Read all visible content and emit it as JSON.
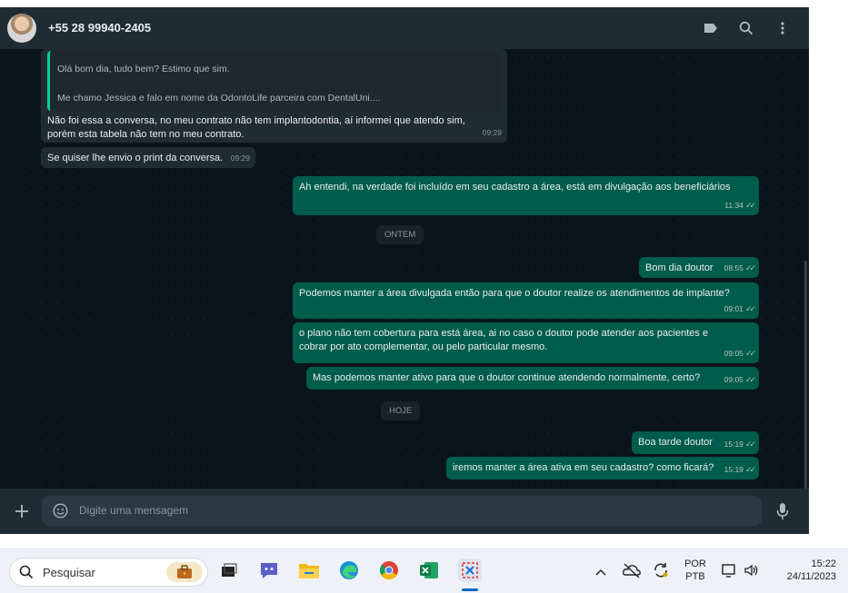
{
  "contact": {
    "name": "+55 28 99940-2405"
  },
  "messages": {
    "q1": "Olá bom dia, tudo bem? Estimo que sim.",
    "q2": "Me chamo Jessica e falo em nome da OdontoLife parceira com DentalUni....",
    "m1": {
      "text": "Não foi essa a conversa, no meu contrato não tem implantodontia, aí informei que atendo sim, porém esta tabela não tem no meu contrato.",
      "time": "09:29"
    },
    "m2": {
      "text": "Se quiser lhe envio o print da conversa.",
      "time": "09:29"
    },
    "m3": {
      "text": "Ah entendi, na verdade foi incluído em seu cadastro a área, está em divulgação aos beneficiários",
      "time": "11:34"
    },
    "day1": "ONTEM",
    "m4": {
      "text": "Bom dia doutor",
      "time": "08:55"
    },
    "m5": {
      "text": "Podemos manter a área divulgada então para que o doutor realize os atendimentos de implante?",
      "time": "09:01"
    },
    "m6": {
      "text": "o plano não tem cobertura para está área, ai no caso o doutor pode atender aos pacientes e cobrar por ato complementar, ou pelo particular mesmo.",
      "time": "09:05"
    },
    "m7": {
      "text": "Mas podemos manter ativo para que o doutor continue atendendo normalmente, certo?",
      "time": "09:05"
    },
    "day2": "HOJE",
    "m8": {
      "text": "Boa tarde doutor",
      "time": "15:19"
    },
    "m9": {
      "text": "iremos manter a área ativa em seu cadastro? como ficará?",
      "time": "15:19"
    }
  },
  "composer": {
    "placeholder": "Digite uma mensagem"
  },
  "taskbar": {
    "search_label": "Pesquisar",
    "lang1": "POR",
    "lang2": "PTB",
    "time": "15:22",
    "date": "24/11/2023"
  },
  "icons": [
    "label-icon",
    "search-icon",
    "menu-icon",
    "plus-icon",
    "emoji-icon",
    "mic-icon",
    "windows-search-icon",
    "briefcase-icon",
    "task-view-icon",
    "teams-icon",
    "file-explorer-icon",
    "edge-icon",
    "chrome-icon",
    "excel-icon",
    "snipping-tool-icon",
    "chevron-up-icon",
    "onedrive-icon",
    "sync-icon",
    "display-icon",
    "volume-icon"
  ],
  "colors": {
    "outgoing": "#005c4b",
    "incoming": "#202c33",
    "background": "#0b141a",
    "accent": "#06cf9c"
  }
}
